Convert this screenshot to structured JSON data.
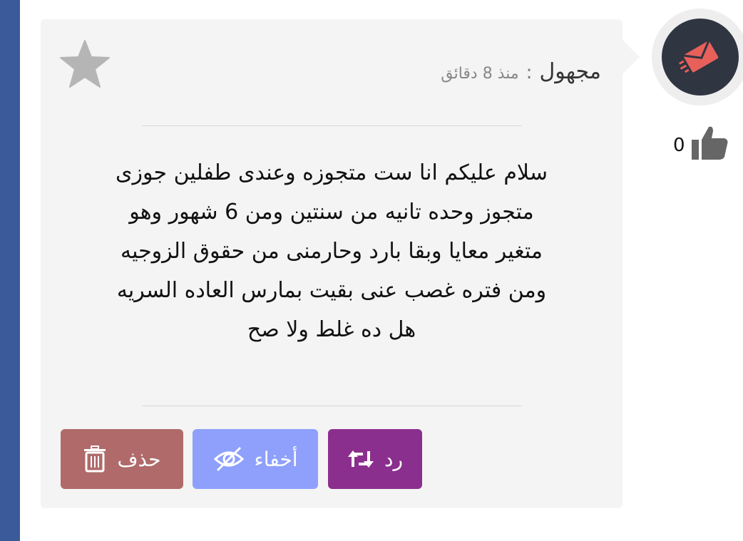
{
  "post": {
    "author": "مجهول",
    "separator": ":",
    "time": "منذ 8 دقائق",
    "lines": [
      "سلام عليكم انا ست متجوزه وعندى طفلين جوزى",
      "متجوز وحده تانيه من سنتين ومن 6 شهور وهو",
      "متغير معايا وبقا بارد وحارمنى من حقوق الزوجيه",
      "ومن فتره غصب عنى بقيت بمارس العاده السريه",
      "هل ده غلط ولا صح"
    ]
  },
  "likes": {
    "count": "0"
  },
  "actions": {
    "reply_label": "رد",
    "hide_label": "أخفاء",
    "delete_label": "حذف"
  },
  "colors": {
    "sidebar": "#3b5a99",
    "card": "#f4f4f4",
    "reply": "#8b2f8f",
    "hide": "#8ea0fb",
    "delete": "#b06a6a",
    "avatar_bg": "#2f3541",
    "avatar_icon": "#e8605a"
  },
  "icons": {
    "avatar": "envelope-icon",
    "like": "thumbs-up-icon",
    "favorite": "star-icon",
    "reply": "retweet-icon",
    "hide": "eye-slash-icon",
    "delete": "trash-icon"
  }
}
